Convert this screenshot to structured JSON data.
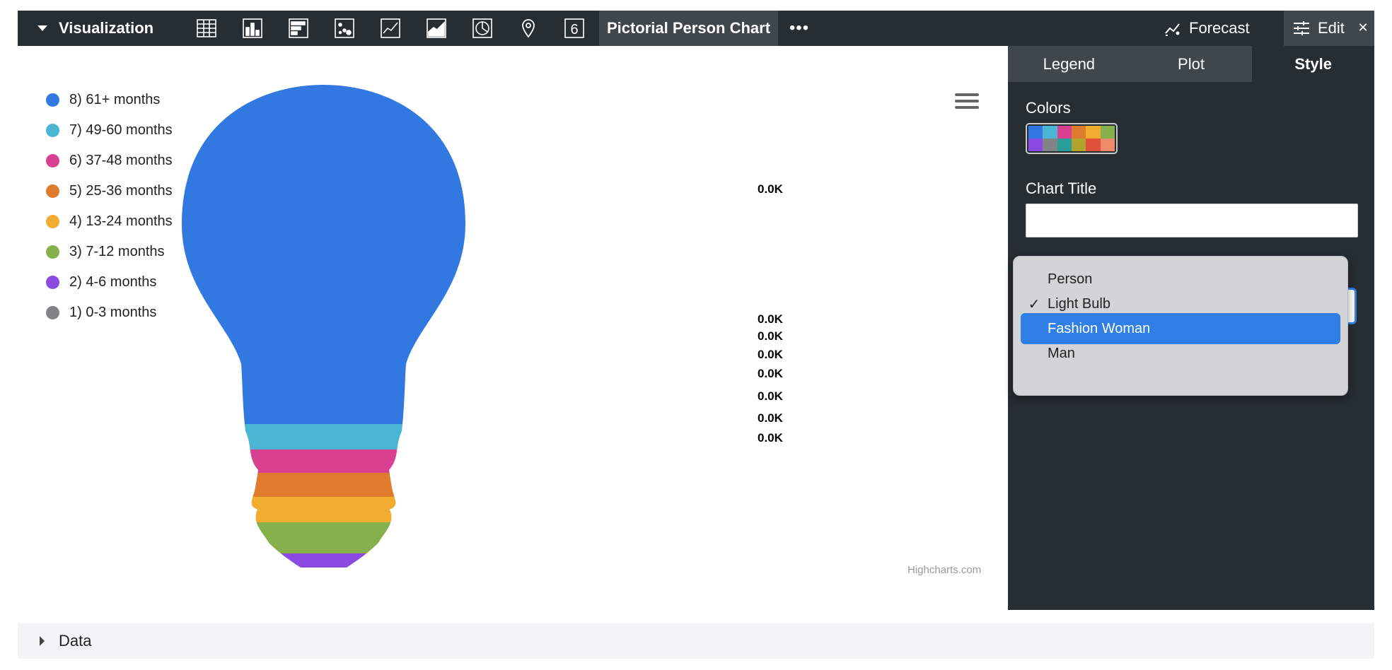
{
  "toolbar": {
    "visualization_label": "Visualization",
    "icons": [
      "table-icon",
      "column-chart-icon",
      "bar-chart-icon",
      "scatter-icon",
      "line-chart-icon",
      "area-chart-icon",
      "pie-chart-icon",
      "map-pin-icon",
      "single-value-icon"
    ],
    "single_value_glyph": "6",
    "active_tab_label": "Pictorial Person Chart",
    "more_label": "•••",
    "forecast_label": "Forecast",
    "edit_label": "Edit",
    "close_glyph": "✕"
  },
  "chart_data": {
    "type": "pictorial",
    "shape": "light-bulb",
    "title": "",
    "series": [
      {
        "name": "8) 61+ months",
        "color": "#3178e1",
        "label": "0.0K"
      },
      {
        "name": "7) 49-60 months",
        "color": "#4bb5d4",
        "label": "0.0K"
      },
      {
        "name": "6) 37-48 months",
        "color": "#d9408f",
        "label": "0.0K"
      },
      {
        "name": "5) 25-36 months",
        "color": "#e07a2c",
        "label": "0.0K"
      },
      {
        "name": "4) 13-24 months",
        "color": "#f2ad31",
        "label": "0.0K"
      },
      {
        "name": "3) 7-12 months",
        "color": "#86b04c",
        "label": "0.0K"
      },
      {
        "name": "2) 4-6 months",
        "color": "#8b4be0",
        "label": "0.0K"
      },
      {
        "name": "1) 0-3 months",
        "color": "#808487",
        "label": "0.0K"
      }
    ],
    "legend_position": "left",
    "credits": "Highcharts.com"
  },
  "panel": {
    "tabs": [
      {
        "label": "Legend",
        "active": false
      },
      {
        "label": "Plot",
        "active": false
      },
      {
        "label": "Style",
        "active": true
      }
    ],
    "colors_label": "Colors",
    "palette": [
      "#3178e1",
      "#4bb5d4",
      "#d9408f",
      "#e07a2c",
      "#f2ad31",
      "#86b04c",
      "#8b4be0",
      "#808487",
      "#2a9c9a",
      "#b1a42e",
      "#e0503a",
      "#f08a6a"
    ],
    "chart_title_label": "Chart Title",
    "chart_title_value": ""
  },
  "dropdown": {
    "options": [
      {
        "label": "Person",
        "checked": false,
        "highlighted": false
      },
      {
        "label": "Light Bulb",
        "checked": true,
        "highlighted": false
      },
      {
        "label": "Fashion Woman",
        "checked": false,
        "highlighted": true
      },
      {
        "label": "Man",
        "checked": false,
        "highlighted": false
      }
    ],
    "check_glyph": "✓"
  },
  "data_section": {
    "label": "Data"
  }
}
